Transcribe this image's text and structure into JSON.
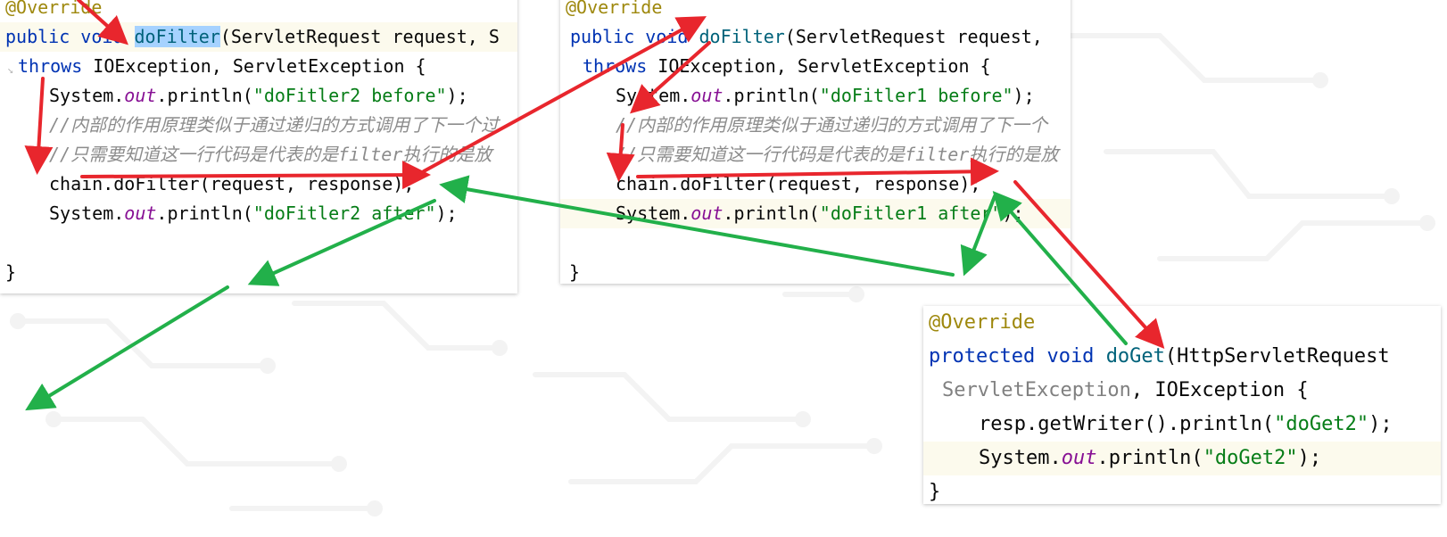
{
  "colors": {
    "keyword": "#0033b3",
    "annotation": "#9e880d",
    "string": "#067d17",
    "field": "#871094",
    "comment": "#8c8c8c",
    "red_arrow": "#e8262d",
    "green_arrow": "#22b04a",
    "selection": "#a6d2ff"
  },
  "panel_filter2": {
    "annotation": "@Override",
    "sig_kw": "public void ",
    "method": "doFilter",
    "sig_rest": "(ServletRequest request, S",
    "throws_kw": "throws",
    "throws_rest": " IOException, ServletException {",
    "print1_obj": "System.",
    "print1_field": "out",
    "print1_call": ".println(",
    "print1_str": "\"doFitler2 before\"",
    "print1_end": ");",
    "comment1": "//内部的作用原理类似于通过递归的方式调用了下一个过",
    "comment2": "//只需要知道这一行代码是代表的是filter执行的是放",
    "chain": "chain.doFilter(request, response);",
    "print2_obj": "System.",
    "print2_field": "out",
    "print2_call": ".println(",
    "print2_str": "\"doFitler2 after\"",
    "print2_end": ");",
    "close": "}"
  },
  "panel_filter1": {
    "annotation": "@Override",
    "sig_kw": "public void ",
    "method": "doFilter",
    "sig_rest": "(ServletRequest request,",
    "throws_kw": "throws",
    "throws_rest": " IOException, ServletException {",
    "print1_obj": "System.",
    "print1_field": "out",
    "print1_call": ".println(",
    "print1_str": "\"doFitler1 before\"",
    "print1_end": ");",
    "comment1": "//内部的作用原理类似于通过递归的方式调用了下一个",
    "comment2": "//只需要知道这一行代码是代表的是filter执行的是放",
    "chain": "chain.doFilter(request, response);",
    "print2_obj": "System.",
    "print2_field": "out",
    "print2_call": ".println(",
    "print2_str": "\"doFitler1 after\"",
    "print2_end": ");",
    "close": "}"
  },
  "panel_servlet": {
    "annotation": "@Override",
    "sig_kw": "protected void ",
    "method": "doGet",
    "sig_rest": "(HttpServletRequest",
    "throws_gray": "ServletException",
    "throws_rest": ", IOException {",
    "resp_line_pre": "resp.getWriter().println(",
    "resp_line_str": "\"doGet2\"",
    "resp_line_end": ");",
    "print_obj": "System.",
    "print_field": "out",
    "print_call": ".println(",
    "print_str": "\"doGet2\"",
    "print_end": ");",
    "close": "}"
  }
}
